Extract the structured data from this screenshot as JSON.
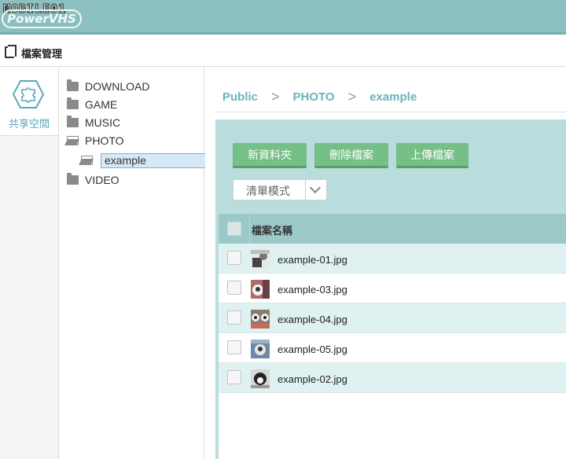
{
  "header": {
    "brand_text": "MOBILE01",
    "logo_text": "PowerVHS"
  },
  "titlebar": {
    "title": "檔案管理"
  },
  "leftnav": {
    "share_label": "共享空間"
  },
  "tree": {
    "items": [
      {
        "label": "DOWNLOAD",
        "state": "closed"
      },
      {
        "label": "GAME",
        "state": "closed"
      },
      {
        "label": "MUSIC",
        "state": "closed"
      },
      {
        "label": "PHOTO",
        "state": "open"
      },
      {
        "label": "example",
        "state": "selected"
      },
      {
        "label": "VIDEO",
        "state": "closed"
      }
    ]
  },
  "breadcrumb": {
    "items": [
      "Public",
      "PHOTO",
      "example"
    ],
    "separator": ">"
  },
  "toolbar": {
    "new_folder": "新資料夾",
    "delete_file": "刪除檔案",
    "upload_file": "上傳檔案",
    "view_mode": "清單模式"
  },
  "table": {
    "header_name": "檔案名稱",
    "rows": [
      {
        "name": "example-01.jpg"
      },
      {
        "name": "example-03.jpg"
      },
      {
        "name": "example-04.jpg"
      },
      {
        "name": "example-05.jpg"
      },
      {
        "name": "example-02.jpg"
      }
    ]
  },
  "colors": {
    "header_bg": "#8cc0c0",
    "accent_text": "#69b3be",
    "button_green": "#76bf87",
    "panel_bg": "#b9dcdc"
  }
}
